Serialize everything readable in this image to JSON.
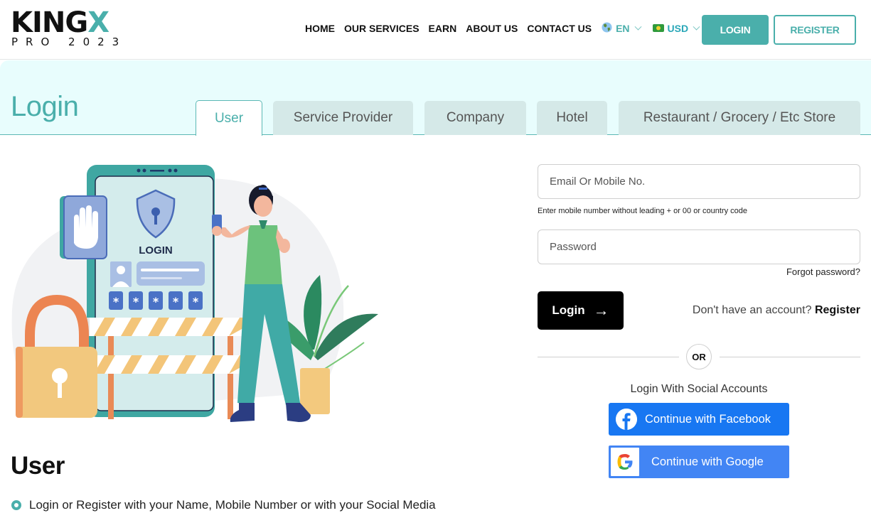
{
  "brand": {
    "name_main": "KING",
    "name_accent": "X",
    "tagline": "PRO 2023",
    "accent_color": "#4aafab"
  },
  "nav": {
    "items": [
      "HOME",
      "OUR SERVICES",
      "EARN",
      "ABOUT US",
      "CONTACT US"
    ],
    "language": {
      "icon": "globe-icon",
      "value": "EN"
    },
    "currency": {
      "icon": "cash-icon",
      "value": "USD"
    },
    "login_label": "LOGIN",
    "register_label": "REGISTER"
  },
  "page": {
    "title": "Login",
    "tabs": [
      {
        "label": "User",
        "active": true
      },
      {
        "label": "Service Provider",
        "active": false
      },
      {
        "label": "Company",
        "active": false
      },
      {
        "label": "Hotel",
        "active": false
      },
      {
        "label": "Restaurant / Grocery / Etc Store",
        "active": false
      }
    ]
  },
  "illustration": {
    "screen_label": "LOGIN",
    "password_mask": [
      "*",
      "*",
      "*",
      "*",
      "*"
    ]
  },
  "form": {
    "email_placeholder": "Email Or Mobile No.",
    "email_value": "",
    "email_hint": "Enter mobile number without leading + or 00 or country code",
    "password_placeholder": "Password",
    "password_value": "",
    "forgot_label": "Forgot password?",
    "login_label": "Login",
    "no_account_text": "Don't have an account?",
    "register_link": "Register",
    "or_label": "OR",
    "social_title": "Login With Social Accounts",
    "facebook_label": "Continue with Facebook",
    "google_label": "Continue with Google"
  },
  "info": {
    "title": "User",
    "bullets": [
      "Login or Register with your Name, Mobile Number or with your Social Media"
    ]
  }
}
